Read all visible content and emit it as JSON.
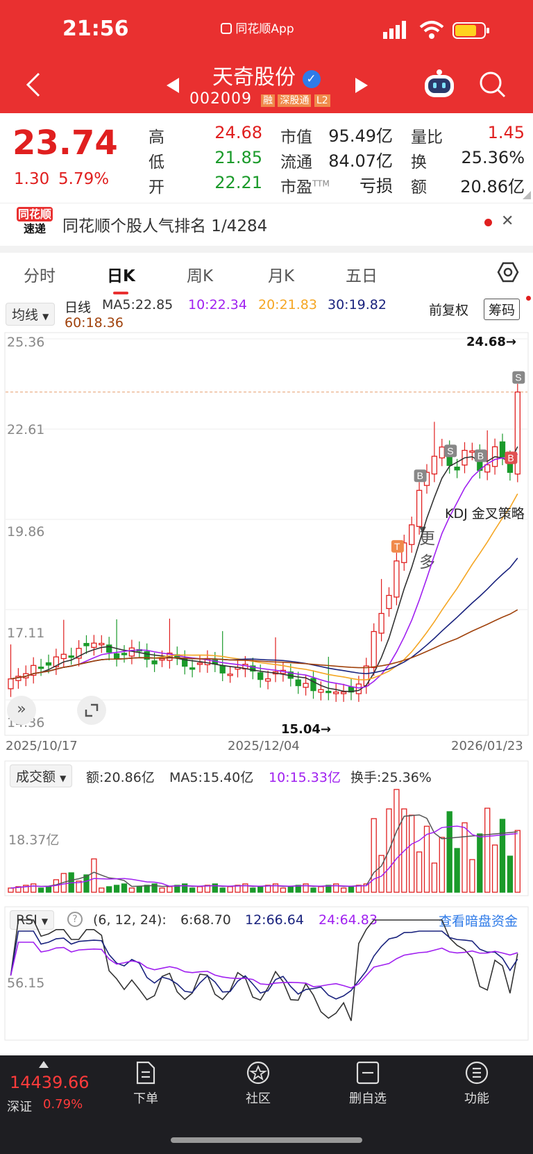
{
  "status": {
    "time": "21:56",
    "app_name": "同花顺App"
  },
  "header": {
    "stock_name": "天奇股份",
    "stock_code": "002009",
    "badges": [
      "融",
      "深股通",
      "L2"
    ]
  },
  "quote": {
    "price": "23.74",
    "change": "1.30",
    "change_pct": "5.79%",
    "high_label": "高",
    "high": "24.68",
    "low_label": "低",
    "low": "21.85",
    "open_label": "开",
    "open": "22.21",
    "mktcap_label": "市值",
    "mktcap": "95.49亿",
    "float_label": "流通",
    "float": "84.07亿",
    "pe_label": "市盈",
    "pe_sup": "TTM",
    "pe": "亏损",
    "vr_label": "量比",
    "vr": "1.45",
    "turn_label": "换",
    "turn": "25.36%",
    "amt_label": "额",
    "amt": "20.86亿"
  },
  "news": {
    "logo_top": "同花顺",
    "logo_bottom": "速递",
    "text": "同花顺个股人气排名 1/4284"
  },
  "tabs": [
    "分时",
    "日K",
    "周K",
    "月K",
    "五日",
    "更多"
  ],
  "kline": {
    "indicator": "均线",
    "period": "日线",
    "ma5": "MA5:22.85",
    "ma10": "10:22.34",
    "ma20": "20:21.83",
    "ma30": "30:19.82",
    "ma60": "60:18.36",
    "fuquan": "前复权",
    "chips": "筹码",
    "y_ticks": [
      "25.36",
      "22.61",
      "19.86",
      "17.11",
      "14.36"
    ],
    "x_ticks": [
      "2025/10/17",
      "2025/12/04",
      "2026/01/23"
    ],
    "high_mark": "24.68→",
    "low_mark": "15.04→",
    "strategy": "KDJ 金叉策略"
  },
  "volume": {
    "indicator": "成交额",
    "amt": "额:20.86亿",
    "ma5": "MA5:15.40亿",
    "ma10": "10:15.33亿",
    "turnover": "换手:25.36%",
    "y_tick": "18.37亿"
  },
  "rsi": {
    "indicator": "RSI",
    "params": "(6, 12, 24):",
    "r6": "6:68.70",
    "r12": "12:66.64",
    "r24": "24:64.83",
    "dark_link": "查看暗盘资金",
    "y_tick": "56.15"
  },
  "bottom": {
    "index_value": "14439.66",
    "index_name": "深证",
    "index_pct": "0.79%",
    "nav": [
      "下单",
      "社区",
      "删自选",
      "功能"
    ]
  },
  "colors": {
    "brand": "#e93030",
    "up": "#e01f1f",
    "down": "#1a9a2a",
    "ma5": "#333333",
    "ma10": "#a020f0",
    "ma20": "#f5a623",
    "ma30": "#1a237e",
    "ma60": "#a0420c"
  },
  "chart_data": {
    "type": "candlestick",
    "x_ticks": [
      "2025/10/17",
      "2025/12/04",
      "2026/01/23"
    ],
    "ylim": [
      14.36,
      25.36
    ],
    "y_ticks": [
      25.36,
      22.61,
      19.86,
      17.11,
      14.36
    ],
    "last": {
      "open": 22.21,
      "high": 24.68,
      "low": 21.85,
      "close": 23.74
    },
    "period_high": 24.68,
    "period_low": 15.04
  }
}
